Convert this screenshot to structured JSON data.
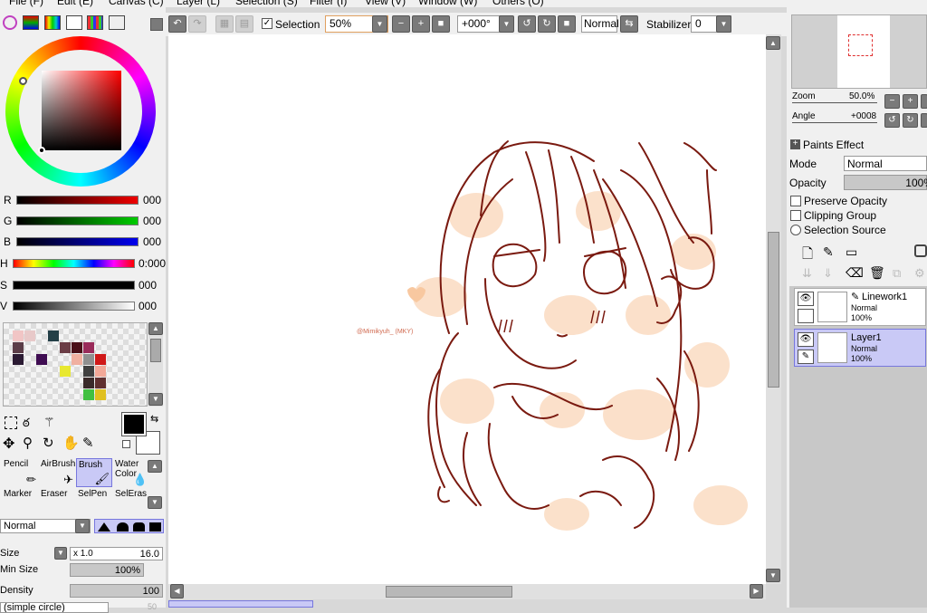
{
  "menu": [
    "File (F)",
    "Edit (E)",
    "Canvas (C)",
    "Layer (L)",
    "Selection (S)",
    "Filter (I)",
    "View (V)",
    "Window (W)",
    "Others (O)"
  ],
  "toolbar": {
    "selection_label": "Selection",
    "zoom_value": "50%",
    "angle_value": "+000°",
    "blend_value": "Normal",
    "stabilizer_label": "Stabilizer",
    "stabilizer_value": "0"
  },
  "color": {
    "rows": [
      {
        "label": "R",
        "value": "000",
        "color": "#e00000"
      },
      {
        "label": "G",
        "value": "000",
        "color": "#00c000"
      },
      {
        "label": "B",
        "value": "000",
        "color": "#0000e0"
      },
      {
        "label": "H",
        "value": "0:000",
        "color": "hue"
      },
      {
        "label": "S",
        "value": "000",
        "color": "#000000"
      },
      {
        "label": "V",
        "value": "000",
        "color": "#ffffff"
      }
    ]
  },
  "swatches": [
    "#f1c5c5",
    "#e8c9c9",
    "#ffffff",
    "#233f47",
    "#ffffff",
    "#ffffff",
    "#ffffff",
    "#ffffff",
    "#5b3d48",
    "#ffffff",
    "#ffffff",
    "#ffffff",
    "#6b3d46",
    "#4b1019",
    "#9a2b5a",
    "#ffffff",
    "#2b1b33",
    "#ffffff",
    "#3f0d52",
    "#ffffff",
    "#ffffff",
    "#f0b0a0",
    "#909090",
    "#d01818",
    "#ffffff",
    "#ffffff",
    "#ffffff",
    "#ffffff",
    "#e8e830",
    "#ffffff",
    "#404040",
    "#f2a898",
    "#ffffff",
    "#ffffff",
    "#ffffff",
    "#ffffff",
    "#ffffff",
    "#ffffff",
    "#3a2a2a",
    "#603030",
    "#ffffff",
    "#ffffff",
    "#ffffff",
    "#ffffff",
    "#ffffff",
    "#ffffff",
    "#40c040",
    "#e0c020"
  ],
  "tools": [
    {
      "label": "Pencil",
      "selected": false
    },
    {
      "label": "AirBrush",
      "selected": false
    },
    {
      "label": "Brush",
      "selected": true
    },
    {
      "label": "Water Color",
      "selected": false
    },
    {
      "label": "Marker",
      "selected": false
    },
    {
      "label": "Eraser",
      "selected": false
    },
    {
      "label": "SelPen",
      "selected": false
    },
    {
      "label": "SelEras",
      "selected": false
    }
  ],
  "brush": {
    "blend": "Normal",
    "size_label": "Size",
    "size_multiplier": "x 1.0",
    "size_value": "16.0",
    "min_size_label": "Min Size",
    "min_size_value": "100%",
    "density_label": "Density",
    "density_value": "100",
    "shape": "(simple circle)",
    "shape_value": "50"
  },
  "canvas": {
    "signature": "@Mimikyuh_ (MKY)"
  },
  "navigator": {
    "zoom_label": "Zoom",
    "zoom_value": "50.0%",
    "angle_label": "Angle",
    "angle_value": "+0008"
  },
  "layer_props": {
    "paints_effect": "Paints Effect",
    "mode_label": "Mode",
    "mode_value": "Normal",
    "opacity_label": "Opacity",
    "opacity_value": "100%",
    "preserve_opacity": "Preserve Opacity",
    "clipping_group": "Clipping Group",
    "selection_source": "Selection Source"
  },
  "layers": [
    {
      "name": "Linework1",
      "mode": "Normal",
      "opacity": "100%",
      "selected": false
    },
    {
      "name": "Layer1",
      "mode": "Normal",
      "opacity": "100%",
      "selected": true
    }
  ],
  "accent": "#c9c9f6",
  "line_color": "#7a1a10"
}
